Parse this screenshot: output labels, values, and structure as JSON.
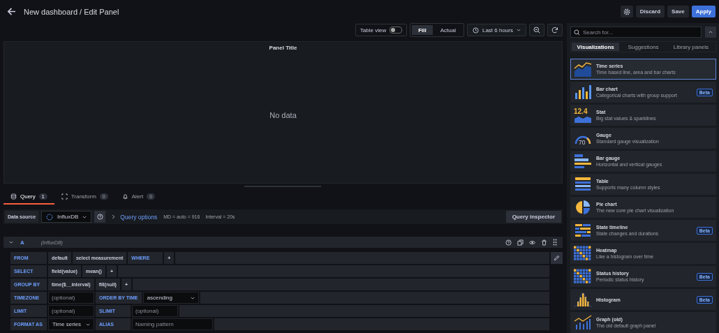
{
  "header": {
    "title": "New dashboard / Edit Panel",
    "buttons": [
      {
        "label": "Discard",
        "kind": "secondary"
      },
      {
        "label": "Save",
        "kind": "secondary"
      },
      {
        "label": "Apply",
        "kind": "primary"
      }
    ]
  },
  "toolbar": {
    "table_view": {
      "label": "Table view",
      "on": false
    },
    "fill_modes": [
      {
        "label": "Fill",
        "selected": true
      },
      {
        "label": "Actual",
        "selected": false
      }
    ],
    "time_range": "Last 6 hours"
  },
  "panel": {
    "title": "Panel Title",
    "message": "No data"
  },
  "query_tabs": [
    {
      "label": "Query",
      "count": "1",
      "selected": true
    },
    {
      "label": "Transform",
      "count": "0",
      "selected": false
    },
    {
      "label": "Alert",
      "count": "0",
      "selected": false
    }
  ],
  "data_source": {
    "label": "Data source",
    "value": "InfluxDB",
    "query_options": "Query options",
    "md": "MD = auto = 916",
    "interval": "Interval = 20s",
    "inspector": "Query inspector"
  },
  "query": {
    "ref": "A",
    "source": "(InfluxDB)"
  },
  "editor_rows": [
    {
      "label": "FROM",
      "parts": [
        {
          "kind": "tag",
          "text": "default"
        },
        {
          "kind": "tag",
          "text": "select measurement"
        },
        {
          "kind": "label",
          "text": "WHERE"
        },
        {
          "kind": "plus",
          "text": "+"
        }
      ]
    },
    {
      "label": "SELECT",
      "parts": [
        {
          "kind": "tag",
          "text": "field(value)"
        },
        {
          "kind": "tag",
          "text": "mean()"
        },
        {
          "kind": "plus",
          "text": "+"
        }
      ]
    },
    {
      "label": "GROUP BY",
      "parts": [
        {
          "kind": "tag",
          "text": "time($__interval)"
        },
        {
          "kind": "tag",
          "text": "fill(null)"
        },
        {
          "kind": "plus",
          "text": "+"
        }
      ]
    },
    {
      "label": "TIMEZONE",
      "parts": [
        {
          "kind": "input",
          "placeholder": "(optional)"
        },
        {
          "kind": "label",
          "text": "ORDER BY TIME"
        },
        {
          "kind": "select",
          "text": "ascending"
        }
      ]
    },
    {
      "label": "LIMIT",
      "parts": [
        {
          "kind": "input",
          "placeholder": "(optional)"
        },
        {
          "kind": "label",
          "text": "SLIMIT"
        },
        {
          "kind": "input",
          "placeholder": "(optional)"
        }
      ]
    },
    {
      "label": "FORMAT AS",
      "parts": [
        {
          "kind": "select",
          "text": "Time series"
        },
        {
          "kind": "label",
          "text": "ALIAS"
        },
        {
          "kind": "input",
          "placeholder": "Naming pattern"
        }
      ]
    }
  ],
  "viz": {
    "search_placeholder": "Search for...",
    "tabs": [
      {
        "label": "Visualizations",
        "selected": true
      },
      {
        "label": "Suggestions",
        "selected": false
      },
      {
        "label": "Library panels",
        "selected": false
      }
    ],
    "items": [
      {
        "kind": "timeseries",
        "name": "Time series",
        "description": "Time based line, area and bar charts",
        "selected": true
      },
      {
        "kind": "bar",
        "name": "Bar chart",
        "description": "Categorical charts with group support",
        "badge": "Beta",
        "selected": false
      },
      {
        "kind": "stat",
        "name": "Stat",
        "description": "Big stat values & sparklines",
        "icon_text": "12.4",
        "selected": false
      },
      {
        "kind": "gauge",
        "name": "Gauge",
        "description": "Standard gauge visualization",
        "icon_text": "70",
        "selected": false
      },
      {
        "kind": "bargauge",
        "name": "Bar gauge",
        "description": "Horizontal and vertical gauges",
        "selected": false
      },
      {
        "kind": "table",
        "name": "Table",
        "description": "Supports many column styles",
        "selected": false
      },
      {
        "kind": "pie",
        "name": "Pie chart",
        "description": "The new core pie chart visualization",
        "selected": false
      },
      {
        "kind": "statetimeline",
        "name": "State timeline",
        "description": "State changes and durations",
        "badge": "Beta",
        "selected": false
      },
      {
        "kind": "heatmap",
        "name": "Heatmap",
        "description": "Like a histogram over time",
        "selected": false
      },
      {
        "kind": "statushistory",
        "name": "Status history",
        "description": "Periodic status history",
        "badge": "Beta",
        "selected": false
      },
      {
        "kind": "histogram",
        "name": "Histogram",
        "badge": "Beta",
        "selected": false
      },
      {
        "kind": "graph",
        "name": "Graph (old)",
        "description": "The old default graph panel",
        "selected": false
      }
    ]
  }
}
